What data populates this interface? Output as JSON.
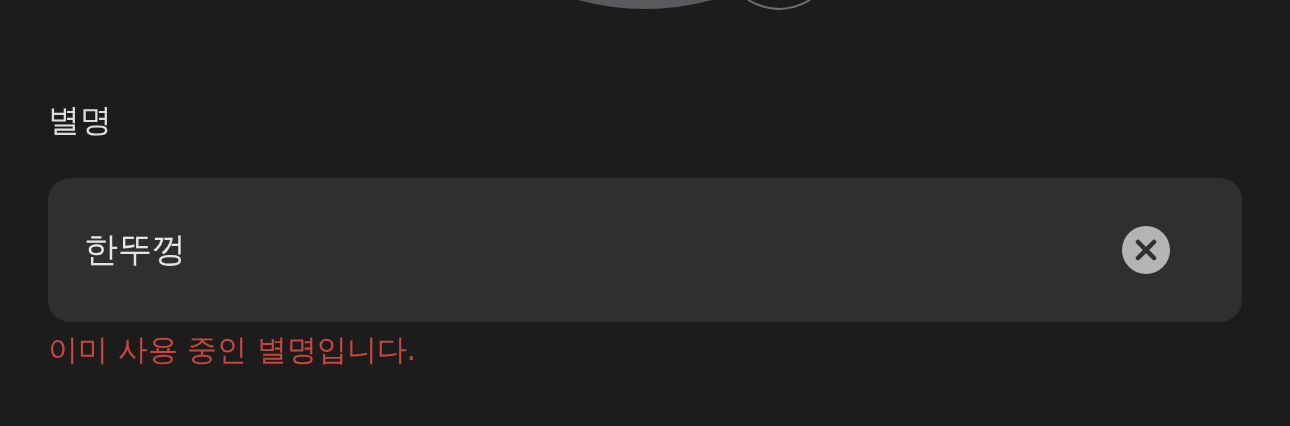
{
  "nickname": {
    "label": "별명",
    "value": "한뚜껑",
    "error": "이미 사용 중인 별명입니다."
  }
}
